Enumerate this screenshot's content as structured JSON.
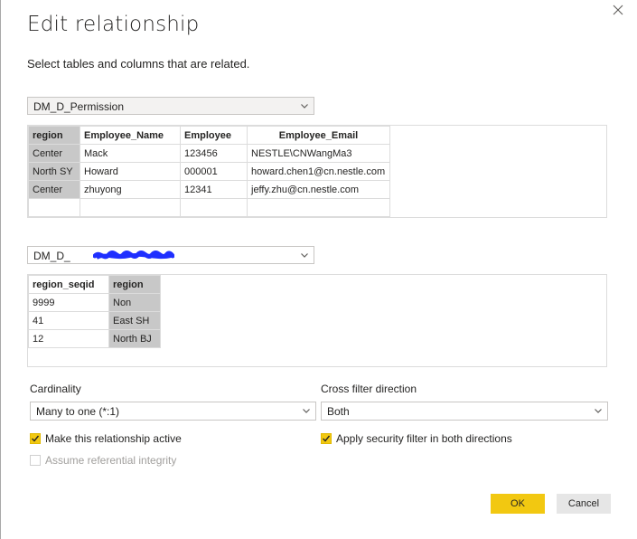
{
  "dialog": {
    "title": "Edit relationship",
    "subtitle": "Select tables and columns that are related."
  },
  "table1": {
    "selected": "DM_D_Permission",
    "columns": [
      "region",
      "Employee_Name",
      "Employee",
      "Employee_Email"
    ],
    "rows": [
      [
        "Center",
        "Mack",
        "123456",
        "NESTLE\\CNWangMa3"
      ],
      [
        "North SY",
        "Howard",
        "000001",
        "howard.chen1@cn.nestle.com"
      ],
      [
        "Center",
        "zhuyong",
        "12341",
        "jeffy.zhu@cn.nestle.com"
      ]
    ],
    "selected_column": "region"
  },
  "table2": {
    "selected_visible_prefix": "DM_D_",
    "columns": [
      "region_seqid",
      "region"
    ],
    "rows": [
      [
        "9999",
        "Non"
      ],
      [
        "41",
        "East SH"
      ],
      [
        "12",
        "North BJ"
      ]
    ],
    "selected_column": "region"
  },
  "cardinality": {
    "label": "Cardinality",
    "value": "Many to one (*:1)"
  },
  "cross_filter": {
    "label": "Cross filter direction",
    "value": "Both"
  },
  "options": {
    "active_label": "Make this relationship active",
    "active_checked": true,
    "security_label": "Apply security filter in both directions",
    "security_checked": true,
    "integrity_label": "Assume referential integrity",
    "integrity_checked": false
  },
  "buttons": {
    "ok": "OK",
    "cancel": "Cancel"
  },
  "colors": {
    "accent": "#f2c811",
    "selected_column": "#c8c8c8",
    "redaction": "#1f2fff"
  },
  "icons": {
    "close": "close-icon",
    "dropdown": "chevron-down-icon",
    "check": "checkmark-icon"
  }
}
